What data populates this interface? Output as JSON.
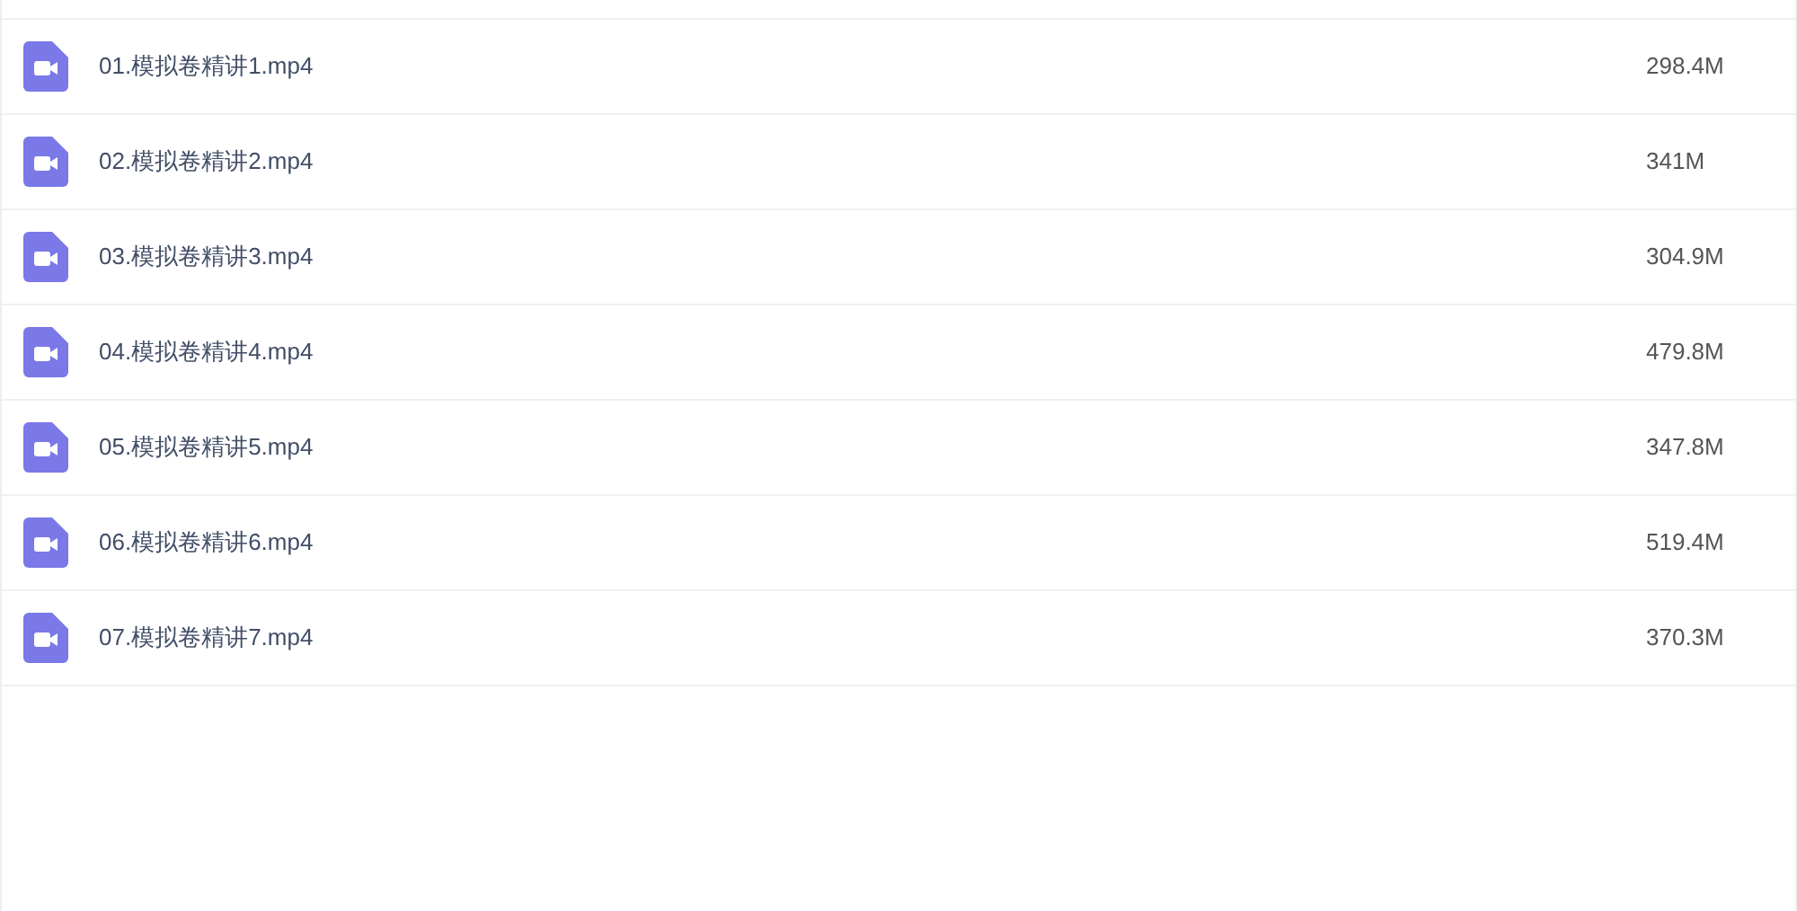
{
  "files": [
    {
      "name": "01.模拟卷精讲1.mp4",
      "size": "298.4M"
    },
    {
      "name": "02.模拟卷精讲2.mp4",
      "size": "341M"
    },
    {
      "name": "03.模拟卷精讲3.mp4",
      "size": "304.9M"
    },
    {
      "name": "04.模拟卷精讲4.mp4",
      "size": "479.8M"
    },
    {
      "name": "05.模拟卷精讲5.mp4",
      "size": "347.8M"
    },
    {
      "name": "06.模拟卷精讲6.mp4",
      "size": "519.4M"
    },
    {
      "name": "07.模拟卷精讲7.mp4",
      "size": "370.3M"
    }
  ]
}
